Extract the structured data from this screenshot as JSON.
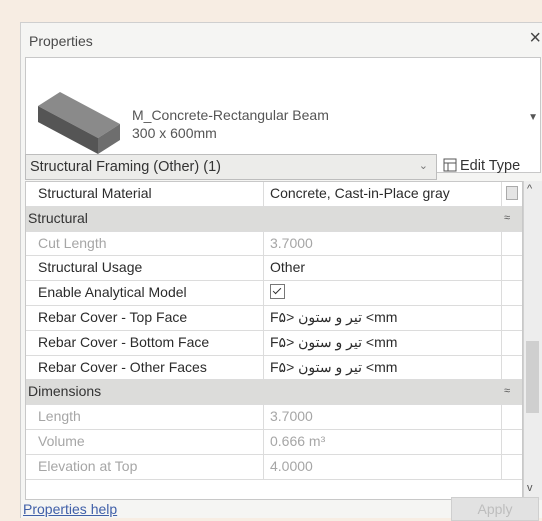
{
  "panel": {
    "title": "Properties",
    "close_symbol": "×"
  },
  "type": {
    "family": "M_Concrete-Rectangular Beam",
    "size": "300 x 600mm"
  },
  "selector": {
    "label": "Structural Framing (Other) (1)"
  },
  "edit_type": {
    "label": "Edit Type"
  },
  "rows": [
    {
      "kind": "prop",
      "name": "Structural Material",
      "value": "Concrete, Cast-in-Place gray"
    },
    {
      "kind": "group",
      "name": "Structural",
      "collapse": "≈"
    },
    {
      "kind": "prop",
      "name": "Cut Length",
      "value": "3.7000",
      "dim": true
    },
    {
      "kind": "prop",
      "name": "Structural Usage",
      "value": "Other"
    },
    {
      "kind": "prop",
      "name": "Enable Analytical Model",
      "value": "",
      "checkbox": true
    },
    {
      "kind": "prop",
      "name": "Rebar Cover - Top Face",
      "value": "F۵> تیر و ستون <mm"
    },
    {
      "kind": "prop",
      "name": "Rebar Cover - Bottom Face",
      "value": "F۵> تیر و ستون <mm"
    },
    {
      "kind": "prop",
      "name": "Rebar Cover - Other Faces",
      "value": "F۵> تیر و ستون <mm"
    },
    {
      "kind": "group",
      "name": "Dimensions",
      "collapse": "≈"
    },
    {
      "kind": "prop",
      "name": "Length",
      "value": "3.7000",
      "dim": true
    },
    {
      "kind": "prop",
      "name": "Volume",
      "value": "0.666 m³",
      "dim": true
    },
    {
      "kind": "prop",
      "name": "Elevation at Top",
      "value": "4.0000",
      "dim": true
    }
  ],
  "footer": {
    "help_label": "Properties help",
    "apply_label": "Apply"
  }
}
